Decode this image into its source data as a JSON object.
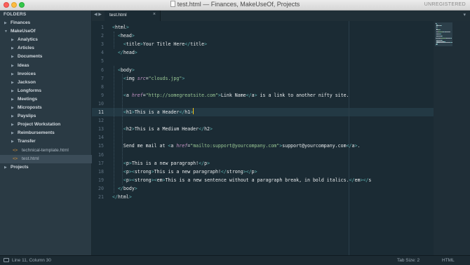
{
  "window": {
    "title": "test.html — Finances, MakeUseOf, Projects",
    "license": "UNREGISTERED"
  },
  "sidebar": {
    "header": "FOLDERS",
    "tree": [
      {
        "label": "Finances",
        "kind": "folder",
        "level": 0,
        "expanded": false
      },
      {
        "label": "MakeUseOf",
        "kind": "folder",
        "level": 0,
        "expanded": true
      },
      {
        "label": "Analytics",
        "kind": "folder",
        "level": 1,
        "expanded": false
      },
      {
        "label": "Articles",
        "kind": "folder",
        "level": 1,
        "expanded": false
      },
      {
        "label": "Documents",
        "kind": "folder",
        "level": 1,
        "expanded": false
      },
      {
        "label": "Ideas",
        "kind": "folder",
        "level": 1,
        "expanded": false
      },
      {
        "label": "Invoices",
        "kind": "folder",
        "level": 1,
        "expanded": false
      },
      {
        "label": "Jackson",
        "kind": "folder",
        "level": 1,
        "expanded": false
      },
      {
        "label": "Longforms",
        "kind": "folder",
        "level": 1,
        "expanded": false
      },
      {
        "label": "Meetings",
        "kind": "folder",
        "level": 1,
        "expanded": false
      },
      {
        "label": "Microposts",
        "kind": "folder",
        "level": 1,
        "expanded": false
      },
      {
        "label": "Payslips",
        "kind": "folder",
        "level": 1,
        "expanded": false
      },
      {
        "label": "Project Workstation",
        "kind": "folder",
        "level": 1,
        "expanded": false
      },
      {
        "label": "Reimbursements",
        "kind": "folder",
        "level": 1,
        "expanded": false
      },
      {
        "label": "Transfer",
        "kind": "folder",
        "level": 1,
        "expanded": false
      },
      {
        "label": "technical-template.html",
        "kind": "file",
        "level": 1,
        "selected": false
      },
      {
        "label": "test.html",
        "kind": "file",
        "level": 1,
        "selected": true
      },
      {
        "label": "Projects",
        "kind": "folder",
        "level": 0,
        "expanded": false
      }
    ]
  },
  "tabs": {
    "nav_left": "◀",
    "nav_right": "▶",
    "active": {
      "label": "test.html",
      "close": "×"
    },
    "menu": "▾"
  },
  "editor": {
    "current_line": 11,
    "lines": [
      [
        [
          "tg",
          "<"
        ],
        [
          "tn",
          "html"
        ],
        [
          "tg",
          ">"
        ]
      ],
      [
        [
          "tx",
          "  "
        ],
        [
          "tg",
          "<"
        ],
        [
          "tn",
          "head"
        ],
        [
          "tg",
          ">"
        ]
      ],
      [
        [
          "tx",
          "    "
        ],
        [
          "tg",
          "<"
        ],
        [
          "tn",
          "title"
        ],
        [
          "tg",
          ">"
        ],
        [
          "tx",
          "Your Title Here"
        ],
        [
          "tg",
          "</"
        ],
        [
          "tn",
          "title"
        ],
        [
          "tg",
          ">"
        ]
      ],
      [
        [
          "tx",
          "  "
        ],
        [
          "tg",
          "</"
        ],
        [
          "tn",
          "head"
        ],
        [
          "tg",
          ">"
        ]
      ],
      [],
      [
        [
          "tx",
          "  "
        ],
        [
          "tg",
          "<"
        ],
        [
          "tn",
          "body"
        ],
        [
          "tg",
          ">"
        ]
      ],
      [
        [
          "tx",
          "    "
        ],
        [
          "tg",
          "<"
        ],
        [
          "tn",
          "img "
        ],
        [
          "an",
          "src"
        ],
        [
          "eq",
          "="
        ],
        [
          "av",
          "\"clouds.jpg\""
        ],
        [
          "tg",
          ">"
        ]
      ],
      [],
      [
        [
          "tx",
          "    "
        ],
        [
          "tg",
          "<"
        ],
        [
          "tn",
          "a "
        ],
        [
          "an",
          "href"
        ],
        [
          "eq",
          "="
        ],
        [
          "av",
          "\"http://somegreatsite.com\""
        ],
        [
          "tg",
          ">"
        ],
        [
          "tx",
          "Link Name"
        ],
        [
          "tg",
          "</"
        ],
        [
          "tn",
          "a"
        ],
        [
          "tg",
          ">"
        ],
        [
          "tx",
          " is a link to another nifty site."
        ]
      ],
      [],
      [
        [
          "tx",
          "    "
        ],
        [
          "tg",
          "<"
        ],
        [
          "tn",
          "h1"
        ],
        [
          "tg",
          ">"
        ],
        [
          "tx",
          "This is a Header"
        ],
        [
          "tg",
          "</"
        ],
        [
          "tn",
          "h1"
        ],
        [
          "tg",
          ">"
        ]
      ],
      [],
      [
        [
          "tx",
          "    "
        ],
        [
          "tg",
          "<"
        ],
        [
          "tn",
          "h2"
        ],
        [
          "tg",
          ">"
        ],
        [
          "tx",
          "This is a Medium Header"
        ],
        [
          "tg",
          "</"
        ],
        [
          "tn",
          "h2"
        ],
        [
          "tg",
          ">"
        ]
      ],
      [],
      [
        [
          "tx",
          "    Send me mail at "
        ],
        [
          "tg",
          "<"
        ],
        [
          "tn",
          "a "
        ],
        [
          "an",
          "href"
        ],
        [
          "eq",
          "="
        ],
        [
          "av",
          "\"mailto:support@yourcompany.com\""
        ],
        [
          "tg",
          ">"
        ],
        [
          "tx",
          "support@yourcompany.com"
        ],
        [
          "tg",
          "</"
        ],
        [
          "tn",
          "a"
        ],
        [
          "tg",
          ">"
        ],
        [
          "tx",
          "."
        ]
      ],
      [],
      [
        [
          "tx",
          "    "
        ],
        [
          "tg",
          "<"
        ],
        [
          "tn",
          "p"
        ],
        [
          "tg",
          ">"
        ],
        [
          "tx",
          "This is a new paragraph!"
        ],
        [
          "tg",
          "</"
        ],
        [
          "tn",
          "p"
        ],
        [
          "tg",
          ">"
        ]
      ],
      [
        [
          "tx",
          "    "
        ],
        [
          "tg",
          "<"
        ],
        [
          "tn",
          "p"
        ],
        [
          "tg",
          ">"
        ],
        [
          "tg",
          "<"
        ],
        [
          "tn",
          "strong"
        ],
        [
          "tg",
          ">"
        ],
        [
          "tx",
          "This is a new paragraph!"
        ],
        [
          "tg",
          "</"
        ],
        [
          "tn",
          "strong"
        ],
        [
          "tg",
          ">"
        ],
        [
          "tg",
          "</"
        ],
        [
          "tn",
          "p"
        ],
        [
          "tg",
          ">"
        ]
      ],
      [
        [
          "tx",
          "    "
        ],
        [
          "tg",
          "<"
        ],
        [
          "tn",
          "p"
        ],
        [
          "tg",
          ">"
        ],
        [
          "tg",
          "<"
        ],
        [
          "tn",
          "strong"
        ],
        [
          "tg",
          ">"
        ],
        [
          "tg",
          "<"
        ],
        [
          "tn",
          "em"
        ],
        [
          "tg",
          ">"
        ],
        [
          "tx",
          "This is a new sentence without a paragraph break, in bold italics."
        ],
        [
          "tg",
          "</"
        ],
        [
          "tn",
          "em"
        ],
        [
          "tg",
          "></"
        ],
        [
          "tn",
          "s"
        ]
      ],
      [
        [
          "tx",
          "  "
        ],
        [
          "tg",
          "</"
        ],
        [
          "tn",
          "body"
        ],
        [
          "tg",
          ">"
        ]
      ],
      [
        [
          "tg",
          "</"
        ],
        [
          "tn",
          "html"
        ],
        [
          "tg",
          ">"
        ]
      ]
    ]
  },
  "status": {
    "position": "Line 11, Column 30",
    "tab_size": "Tab Size: 2",
    "syntax": "HTML"
  },
  "colors": {
    "background": "#1b2b34",
    "sidebar": "#2a3a44",
    "tag": "#5fb3b3",
    "attribute": "#c594c5",
    "string": "#99c794",
    "caret": "#f5c518"
  }
}
